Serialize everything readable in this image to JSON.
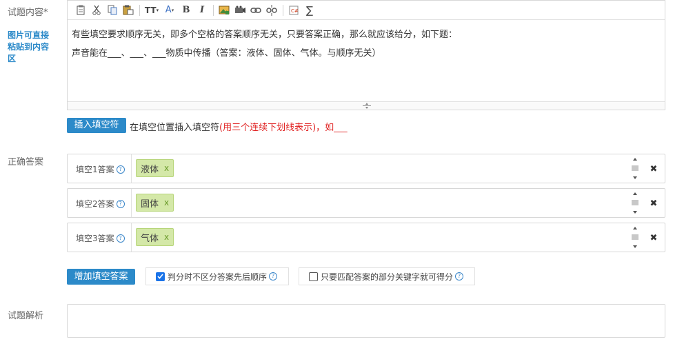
{
  "labels": {
    "content": "试题内容*",
    "paste_hint": [
      "图片可直接",
      "粘贴到内容",
      "区"
    ],
    "correct_answer": "正确答案",
    "analysis": "试题解析"
  },
  "editor": {
    "toolbar": [
      "paste-icon",
      "cut-icon",
      "copy-icon",
      "paste-text-icon",
      "font-size-icon",
      "font-color-icon",
      "bold-icon",
      "italic-icon",
      "image-icon",
      "video-icon",
      "link-icon",
      "unlink-icon",
      "code-icon",
      "formula-icon"
    ],
    "font_size_label": "TT",
    "font_color_label": "A",
    "bold_label": "B",
    "italic_label": "I",
    "formula_label": "∑",
    "line1": "有些填空要求顺序无关，即多个空格的答案顺序无关，只要答案正确，那么就应该给分，如下题：",
    "line2": "声音能在___、___、___物质中传播（答案：液体、固体、气体。与顺序无关）"
  },
  "insert_blank": {
    "button": "插入填空符",
    "hint_plain": "在填空位置插入填空符",
    "hint_red": "(用三个连续下划线表示)，如___"
  },
  "answers": [
    {
      "label": "填空1答案",
      "tag": "液体"
    },
    {
      "label": "填空2答案",
      "tag": "固体"
    },
    {
      "label": "填空3答案",
      "tag": "气体"
    }
  ],
  "tag_remove": "x",
  "help_mark": "?",
  "close_mark": "✖",
  "add_answer_button": "增加填空答案",
  "options": [
    {
      "label": "判分时不区分答案先后顺序",
      "checked": true
    },
    {
      "label": "只要匹配答案的部分关键字就可得分",
      "checked": false
    }
  ],
  "colors": {
    "accent": "#2c8ac9",
    "tag_bg": "#d4e8a8",
    "hint_red": "#e02020"
  }
}
